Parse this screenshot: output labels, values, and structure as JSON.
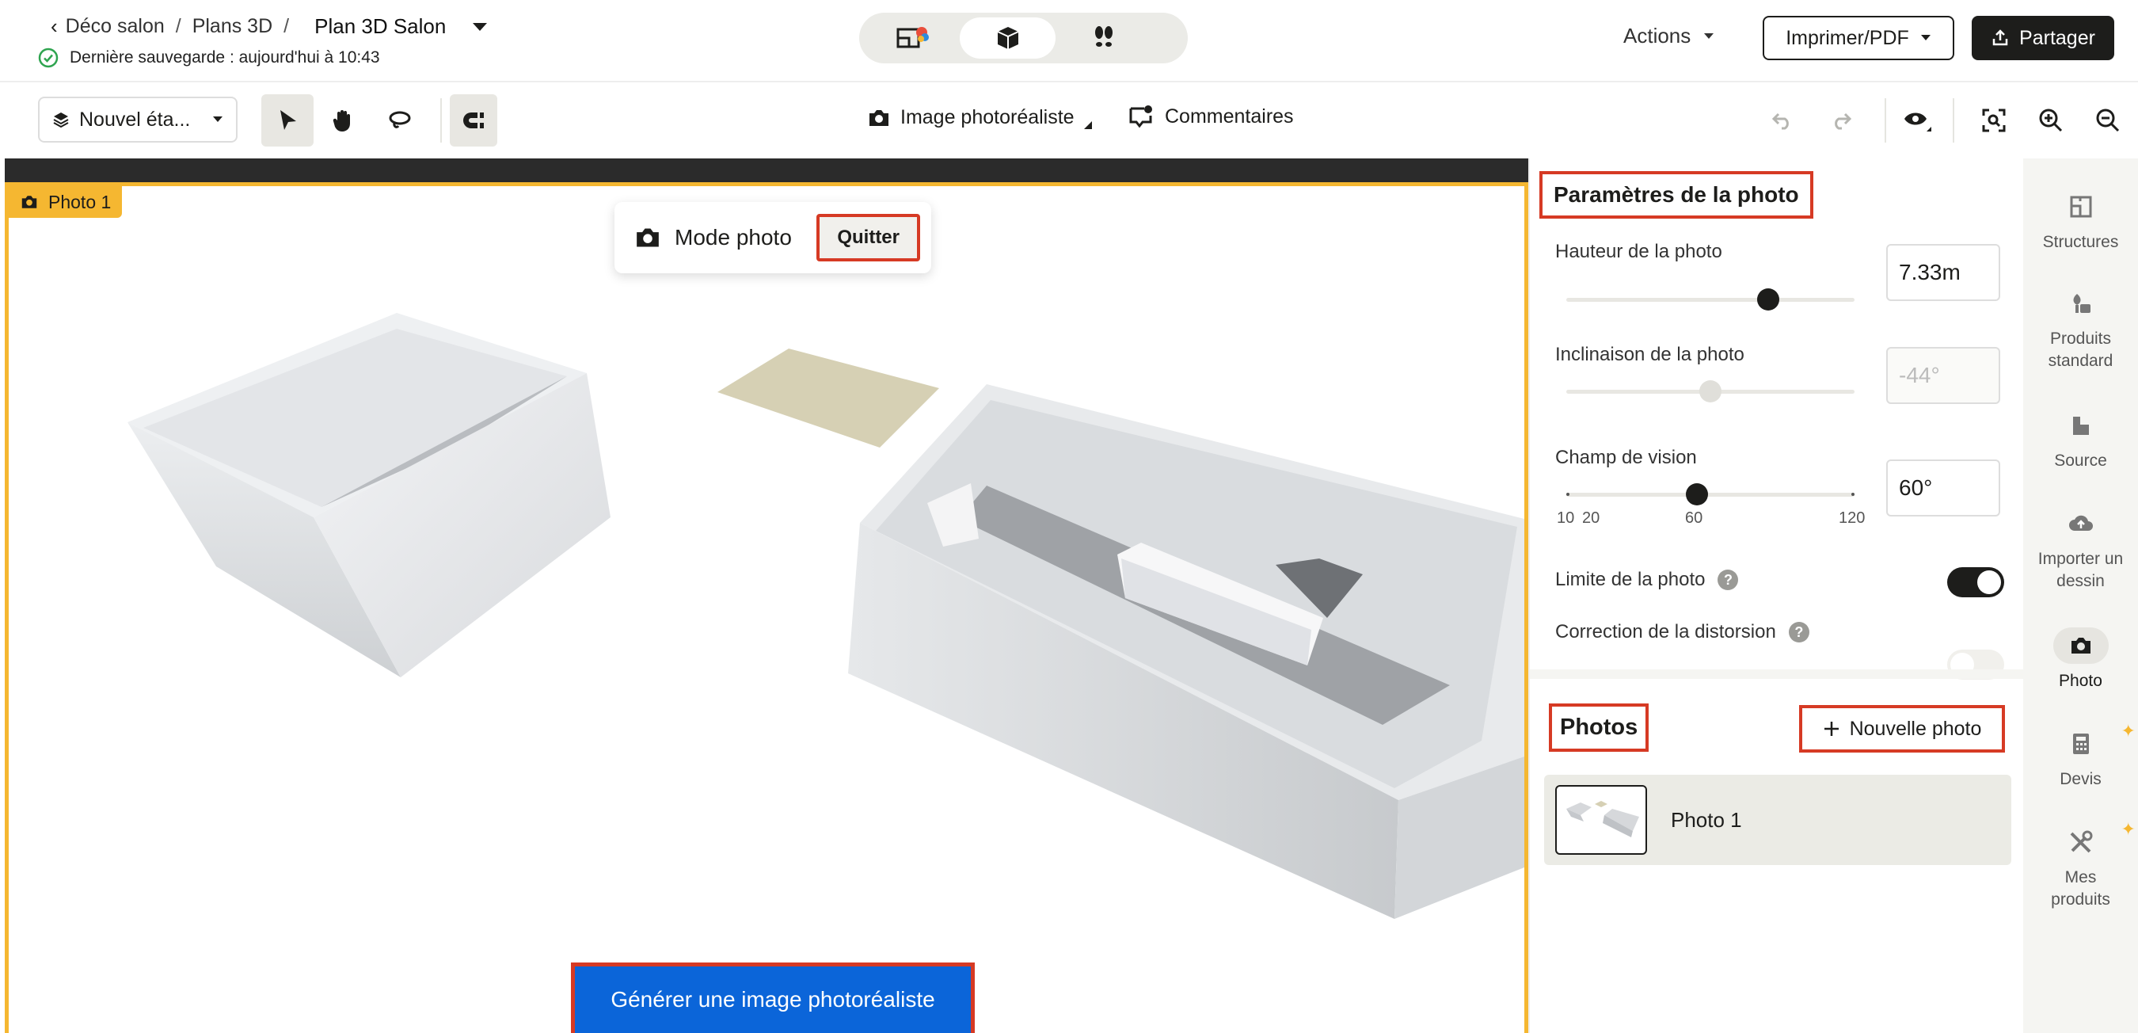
{
  "header": {
    "breadcrumb": [
      "Déco salon",
      "Plans 3D"
    ],
    "breadcrumb_sep": "/",
    "current_plan": "Plan 3D Salon",
    "save_status": "Dernière sauvegarde : aujourd'hui à 10:43",
    "actions_label": "Actions",
    "print_label": "Imprimer/PDF",
    "share_label": "Partager"
  },
  "toolbar": {
    "floor_label": "Nouvel éta...",
    "photoreal_label": "Image photoréaliste",
    "comments_label": "Commentaires"
  },
  "canvas": {
    "photo_label": "Photo 1",
    "mode_photo_label": "Mode photo",
    "quit_label": "Quitter",
    "generate_label": "Générer une image photoréaliste"
  },
  "photo_settings": {
    "title": "Paramètres de la photo",
    "height_label": "Hauteur de la photo",
    "height_value": "7.33m",
    "height_slider": 0.7,
    "tilt_label": "Inclinaison de la photo",
    "tilt_value": "-44°",
    "tilt_slider": 0.5,
    "fov_label": "Champ de vision",
    "fov_value": "60°",
    "fov_slider": 0.4545,
    "fov_ticks": [
      "10",
      "20",
      "60",
      "120"
    ],
    "limit_label": "Limite de la photo",
    "limit_on": true,
    "distortion_label": "Correction de la distorsion",
    "distortion_on": false,
    "help_glyph": "?"
  },
  "photos": {
    "title": "Photos",
    "new_photo_label": "Nouvelle photo",
    "items": [
      {
        "label": "Photo 1"
      }
    ]
  },
  "sidebar": {
    "items": [
      {
        "label": "Structures",
        "icon": "structures-icon"
      },
      {
        "label": "Produits standard",
        "icon": "products-icon"
      },
      {
        "label": "Source",
        "icon": "source-icon"
      },
      {
        "label": "Importer un dessin",
        "icon": "cloud-upload-icon"
      },
      {
        "label": "Photo",
        "icon": "camera-icon"
      },
      {
        "label": "Devis",
        "icon": "calculator-icon"
      },
      {
        "label": "Mes produits",
        "icon": "tools-icon"
      }
    ]
  },
  "colors": {
    "accent": "#0b65d9",
    "highlight": "#d63a24",
    "photo_frame": "#f5b731",
    "dark": "#1d1d1b"
  }
}
